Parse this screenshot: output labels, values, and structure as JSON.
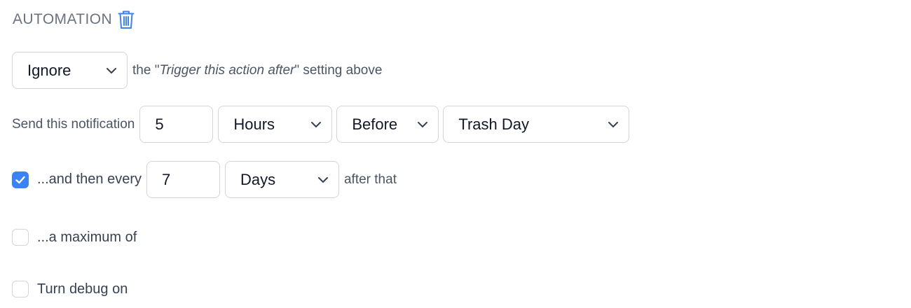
{
  "section": {
    "title": "AUTOMATION",
    "delete_icon": "trash-icon",
    "accent_color": "#3b82f6"
  },
  "trigger_row": {
    "mode_select": {
      "value": "Ignore",
      "icon": "chevron-down-icon"
    },
    "text_prefix": "the \"",
    "text_italic": "Trigger this action after",
    "text_suffix": "\" setting above"
  },
  "send_row": {
    "label": "Send this notification",
    "amount_value": "5",
    "unit_select": {
      "value": "Hours"
    },
    "direction_select": {
      "value": "Before"
    },
    "event_select": {
      "value": "Trash Day"
    }
  },
  "repeat_row": {
    "checked": true,
    "label": "...and then every",
    "interval_value": "7",
    "unit_select": {
      "value": "Days"
    },
    "suffix": "after that"
  },
  "maximum_row": {
    "checked": false,
    "label": "...a maximum of"
  },
  "debug_row": {
    "checked": false,
    "label": "Turn debug on"
  }
}
